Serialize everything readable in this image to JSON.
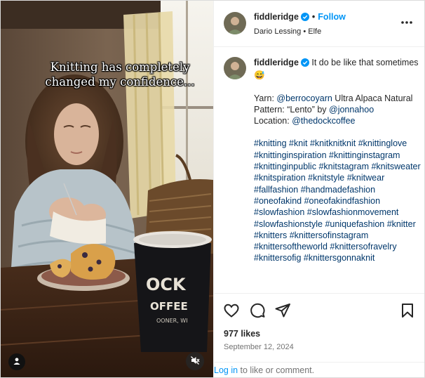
{
  "media": {
    "overlay_text": "Knitting has completely changed my confidence...",
    "cup_text_1": "OCK",
    "cup_text_2": "OFFEE",
    "cup_text_3": "OONER, WI"
  },
  "header": {
    "username": "fiddleridge",
    "follow_label": "Follow",
    "dot": "•",
    "audio_artist": "Dario Lessing",
    "audio_title": "Elfe"
  },
  "caption": {
    "username": "fiddleridge",
    "line1": "It do be like that sometimes 😅",
    "yarn_label": "Yarn: ",
    "yarn_mention": "@berrocoyarn",
    "yarn_rest": " Ultra Alpaca Natural",
    "pattern_label": "Pattern: “Lento” by ",
    "pattern_mention": "@jonnahoo",
    "location_label": "Location: ",
    "location_mention": "@thedockcoffee",
    "hashtags": [
      "#knitting",
      "#knit",
      "#knitknitknit",
      "#knittinglove",
      "#knittinginspiration",
      "#knittinginstagram",
      "#knittinginpublic",
      "#knitstagram",
      "#knitsweater",
      "#knitspiration",
      "#knitstyle",
      "#knitwear",
      "#fallfashion",
      "#handmadefashion",
      "#oneofakind",
      "#oneofakindfashion",
      "#slowfashion",
      "#slowfashionmovement",
      "#slowfashionstyle",
      "#uniquefashion",
      "#knitter",
      "#knitters",
      "#knittersofinstagram",
      "#knittersoftheworld",
      "#knittersofravelry",
      "#knittersofig",
      "#knittersgonnaknit"
    ]
  },
  "stats": {
    "likes": "977 likes",
    "date": "September 12, 2024"
  },
  "login": {
    "link": "Log in",
    "rest": " to like or comment."
  },
  "icons": {
    "like": "heart-icon",
    "comment": "comment-bubble-icon",
    "share": "paper-plane-icon",
    "save": "bookmark-icon",
    "more": "more-horizontal-icon",
    "verified": "verified-badge-icon",
    "mute": "audio-muted-icon",
    "user_tag": "user-tag-icon"
  },
  "colors": {
    "accent": "#0095f6",
    "link": "#00376b",
    "verified": "#0095f6",
    "muted_text": "#737373"
  }
}
